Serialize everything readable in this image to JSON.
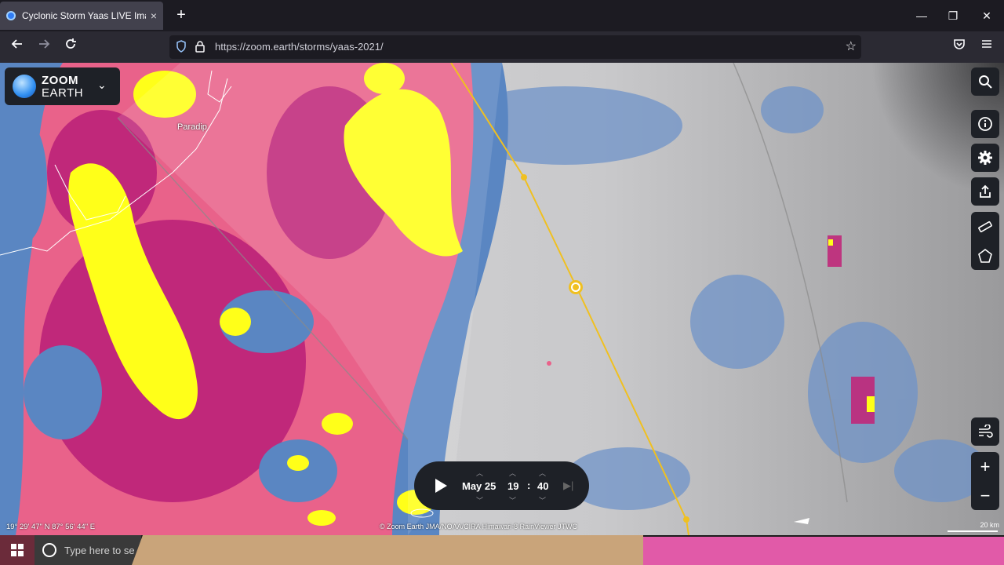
{
  "browser": {
    "tab_title": "Cyclonic Storm Yaas LIVE Image",
    "tab_close": "×",
    "new_tab": "+",
    "url": "https://zoom.earth/storms/yaas-2021/",
    "window_controls": {
      "minimize": "—",
      "maximize": "❐",
      "close": "✕"
    }
  },
  "map": {
    "logo": {
      "line1": "ZOOM",
      "line2": "EARTH"
    },
    "place_label": "Paradip",
    "coordinates": "19° 29' 47\" N  87° 56' 44\" E",
    "credits": "© Zoom Earth  JMA/NOAA/CIRA  Himawari-8  RainViewer  JTWC",
    "scale_label": "20 km",
    "time": {
      "date": "May 25",
      "hour": "19",
      "separator": ":",
      "minute": "40"
    },
    "controls": [
      "search-icon",
      "info-icon",
      "gear-icon",
      "share-icon",
      "ruler-icon",
      "polygon-icon",
      "wind-icon",
      "zoom-in-icon",
      "zoom-out-icon"
    ],
    "colors": {
      "rain_yellow": "#ffff19",
      "rain_pink": "#e9628a",
      "rain_magenta": "#c0287a",
      "rain_blue": "#5a86c2",
      "track": "#f0c020",
      "panel": "#1e2127"
    }
  },
  "taskbar": {
    "search_placeholder": "Type here to se",
    "accent_tan": "#c9a47a",
    "accent_pink": "#e15aa8"
  }
}
